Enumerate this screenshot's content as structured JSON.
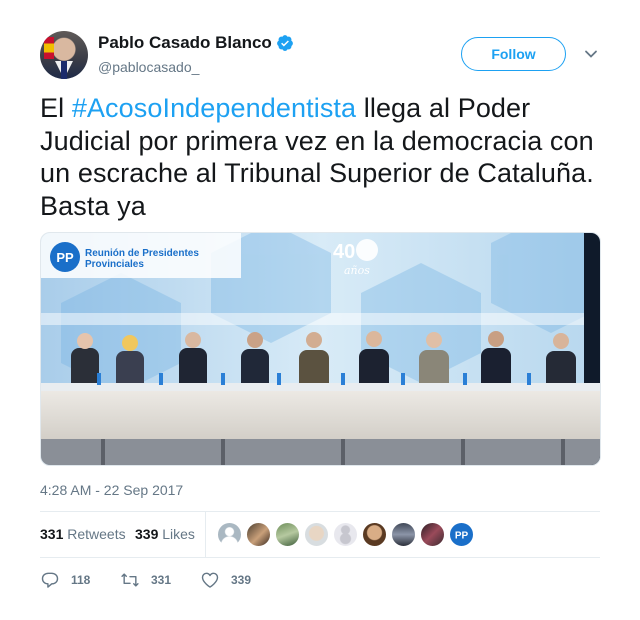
{
  "author": {
    "display_name": "Pablo Casado Blanco",
    "handle": "@pablocasado_",
    "verified": true,
    "avatar_icon": "profile-photo"
  },
  "follow_label": "Follow",
  "tweet": {
    "text_before": "El ",
    "hashtag": "#AcosoIndependentista",
    "text_after": " llega al Poder Judicial por primera vez en la democracia con un escrache al Tribunal Superior de Cataluña. Basta ya"
  },
  "media": {
    "banner_text_line1": "Reunión de Presidentes",
    "banner_text_line2": "Provinciales",
    "logo_text": "PP",
    "anniversary_number": "40",
    "anniversary_word": "años"
  },
  "timestamp": "4:28 AM - 22 Sep 2017",
  "stats": {
    "retweets_count": "331",
    "retweets_label": "Retweets",
    "likes_count": "339",
    "likes_label": "Likes"
  },
  "actions": {
    "reply_count": "118",
    "retweet_count": "331",
    "like_count": "339"
  },
  "colors": {
    "accent": "#1da1f2",
    "text": "#14171a",
    "muted": "#657786",
    "pp_blue": "#1a6fc9"
  }
}
